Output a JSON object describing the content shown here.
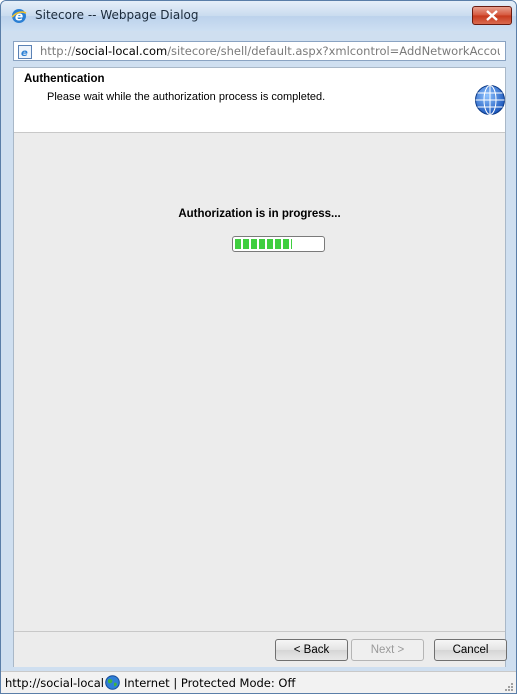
{
  "window": {
    "title": "Sitecore -- Webpage Dialog",
    "close_icon": "close-icon"
  },
  "address": {
    "prefix": "http://",
    "host": "social-local.com",
    "path": "/sitecore/shell/default.aspx?xmlcontrol=AddNetworkAccount&dt"
  },
  "header": {
    "title": "Authentication",
    "subtitle": "Please wait while the authorization process is completed.",
    "icon": "globe-icon"
  },
  "progress": {
    "message": "Authorization is in progress...",
    "fraction": 0.65
  },
  "buttons": {
    "back": "< Back",
    "next": "Next >",
    "cancel": "Cancel"
  },
  "status": {
    "url": "http://social-local",
    "zone": "Internet | Protected Mode: Off"
  },
  "colors": {
    "progress_green": "#3fce3f",
    "close_red": "#c7381c"
  }
}
